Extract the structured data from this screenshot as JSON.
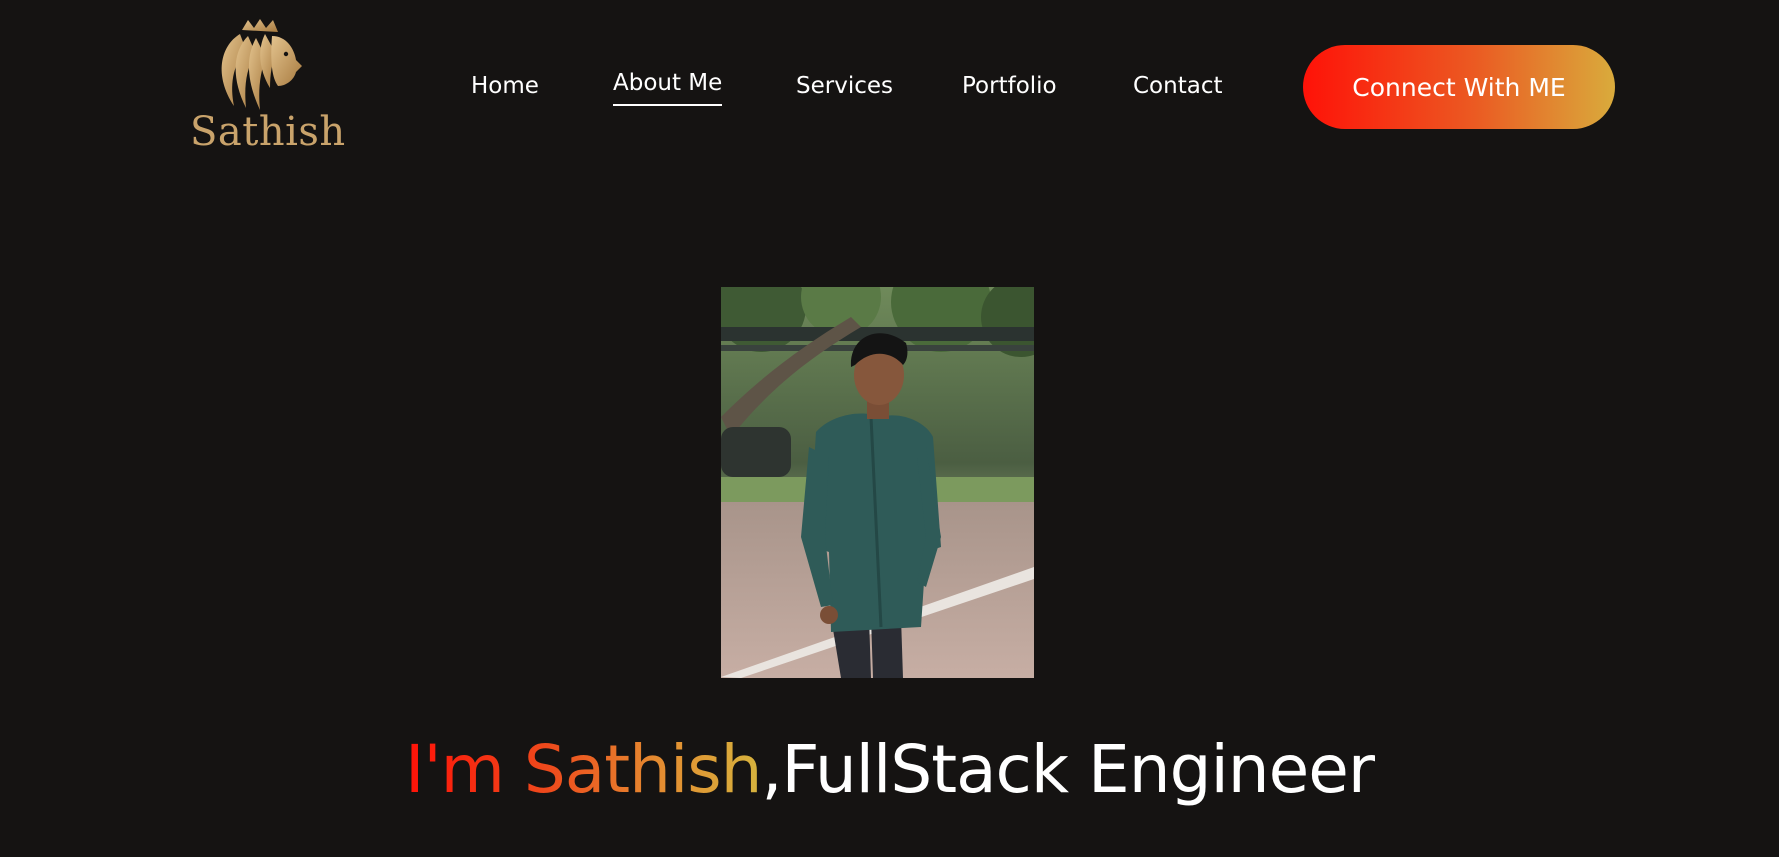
{
  "logo": {
    "text": "Sathish",
    "icon": "lion-head-icon",
    "color": "#c9a36b"
  },
  "nav": {
    "items": [
      {
        "label": "Home",
        "active": false
      },
      {
        "label": "About Me",
        "active": true
      },
      {
        "label": "Services",
        "active": false
      },
      {
        "label": "Portfolio",
        "active": false
      },
      {
        "label": "Contact",
        "active": false
      }
    ]
  },
  "cta": {
    "label": "Connect With ME",
    "gradient": [
      "#ff1208",
      "#eb5a22",
      "#d9ab3c"
    ]
  },
  "hero": {
    "photo_icon": "profile-photo",
    "headline_highlight": "I'm Sathish",
    "headline_rest": ",FullStack Engineer"
  },
  "colors": {
    "background": "#151312",
    "text": "#ffffff",
    "accent_start": "#ff1208",
    "accent_end": "#d9ab3c"
  }
}
